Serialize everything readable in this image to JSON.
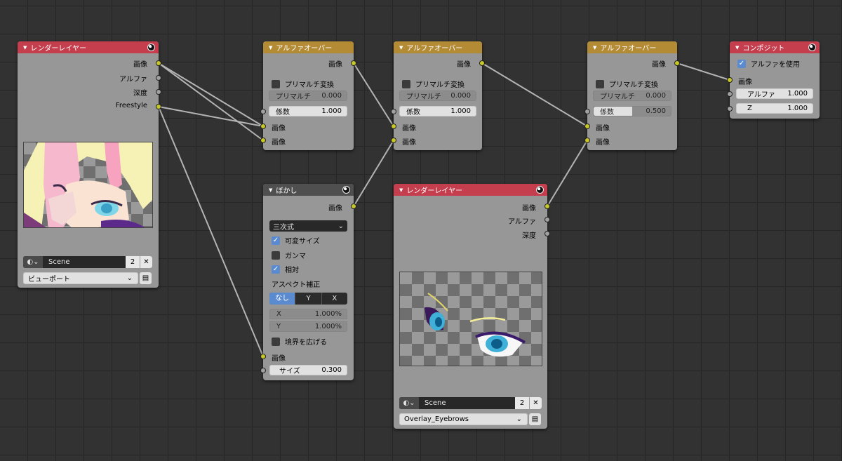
{
  "colors": {
    "socket_image": "#c7c729",
    "socket_value": "#a1a1a1",
    "header_render": "#c43e4e",
    "header_mix": "#b48b35",
    "header_filter": "#4f4f4f",
    "checkbox_on": "#5a8bd0"
  },
  "render_layer_1": {
    "title": "レンダーレイヤー",
    "outputs": [
      "画像",
      "アルファ",
      "深度",
      "Freestyle"
    ],
    "scene": "Scene",
    "users": "2",
    "layer": "ビューポート"
  },
  "alpha_over_1": {
    "title": "アルファオーバー",
    "output": "画像",
    "premult_convert": "プリマルチ変換",
    "premult_label": "プリマルチ",
    "premult_value": "0.000",
    "factor_label": "係数",
    "factor_value": "1.000",
    "inputs": [
      "画像",
      "画像"
    ]
  },
  "alpha_over_2": {
    "title": "アルファオーバー",
    "output": "画像",
    "premult_convert": "プリマルチ変換",
    "premult_label": "プリマルチ",
    "premult_value": "0.000",
    "factor_label": "係数",
    "factor_value": "1.000",
    "inputs": [
      "画像",
      "画像"
    ]
  },
  "alpha_over_3": {
    "title": "アルファオーバー",
    "output": "画像",
    "premult_convert": "プリマルチ変換",
    "premult_label": "プリマルチ",
    "premult_value": "0.000",
    "factor_label": "係数",
    "factor_value": "0.500",
    "factor_fraction": 0.5,
    "inputs": [
      "画像",
      "画像"
    ]
  },
  "composite": {
    "title": "コンポジット",
    "use_alpha": "アルファを使用",
    "input": "画像",
    "alpha_label": "アルファ",
    "alpha_value": "1.000",
    "z_label": "Z",
    "z_value": "1.000"
  },
  "blur": {
    "title": "ぼかし",
    "output": "画像",
    "filter_type": "三次式",
    "variable_size": "可変サイズ",
    "gamma": "ガンマ",
    "relative": "相対",
    "aspect_label": "アスペクト補正",
    "aspect_options": [
      "なし",
      "Y",
      "X"
    ],
    "x_label": "X",
    "x_value": "1.000%",
    "y_label": "Y",
    "y_value": "1.000%",
    "extend_bounds": "境界を広げる",
    "input": "画像",
    "size_label": "サイズ",
    "size_value": "0.300"
  },
  "render_layer_2": {
    "title": "レンダーレイヤー",
    "outputs": [
      "画像",
      "アルファ",
      "深度"
    ],
    "scene": "Scene",
    "users": "2",
    "layer": "Overlay_Eyebrows"
  }
}
